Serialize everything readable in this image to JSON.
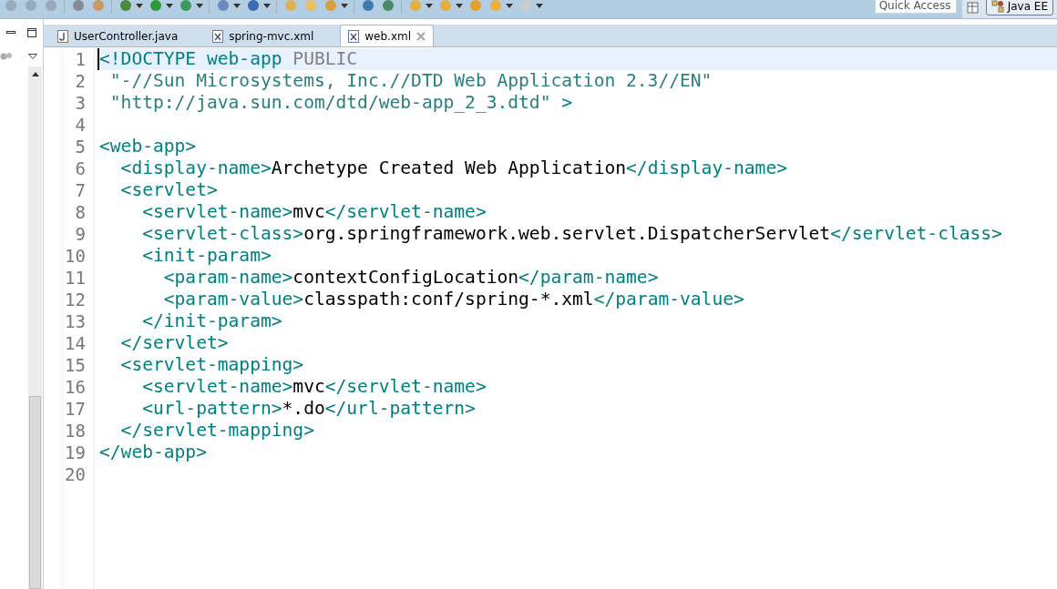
{
  "toolbar": {
    "quick_access": {
      "placeholder": "Quick Access"
    },
    "perspective": {
      "label": "Java EE",
      "selected": true
    }
  },
  "tabs": [
    {
      "label": "UserController.java",
      "kind": "java",
      "selected": false
    },
    {
      "label": "spring-mvc.xml",
      "kind": "xml",
      "selected": false
    },
    {
      "label": "web.xml",
      "kind": "xml",
      "selected": true
    }
  ],
  "editor": {
    "lines": [
      {
        "number": "1",
        "current": true,
        "tokens": [
          {
            "kind": "tag",
            "text": "<!DOCTYPE web-app "
          },
          {
            "kind": "keyword",
            "text": "PUBLIC"
          }
        ]
      },
      {
        "number": "2",
        "current": false,
        "tokens": [
          {
            "kind": "string",
            "text": " \"-//Sun Microsystems, Inc.//DTD Web Application 2.3//EN\""
          }
        ]
      },
      {
        "number": "3",
        "current": false,
        "tokens": [
          {
            "kind": "string",
            "text": " \"http://java.sun.com/dtd/web-app_2_3.dtd\""
          },
          {
            "kind": "tag",
            "text": " >"
          }
        ]
      },
      {
        "number": "4",
        "current": false
      },
      {
        "number": "5",
        "current": false,
        "tokens": [
          {
            "kind": "tag",
            "text": "<web-app>"
          }
        ]
      },
      {
        "number": "6",
        "current": false,
        "tokens": [
          {
            "kind": "tag",
            "text": "  <display-name>"
          },
          {
            "kind": "text",
            "text": "Archetype Created Web Application"
          },
          {
            "kind": "tag",
            "text": "</display-name>"
          }
        ]
      },
      {
        "number": "7",
        "current": false,
        "tokens": [
          {
            "kind": "tag",
            "text": "  <servlet>"
          }
        ]
      },
      {
        "number": "8",
        "current": false,
        "tokens": [
          {
            "kind": "tag",
            "text": "    <servlet-name>"
          },
          {
            "kind": "text",
            "text": "mvc"
          },
          {
            "kind": "tag",
            "text": "</servlet-name>"
          }
        ]
      },
      {
        "number": "9",
        "current": false,
        "tokens": [
          {
            "kind": "tag",
            "text": "    <servlet-class>"
          },
          {
            "kind": "text",
            "text": "org.springframework.web.servlet.DispatcherServlet"
          },
          {
            "kind": "tag",
            "text": "</servlet-class>"
          }
        ]
      },
      {
        "number": "10",
        "current": false,
        "tokens": [
          {
            "kind": "tag",
            "text": "    <init-param>"
          }
        ]
      },
      {
        "number": "11",
        "current": false,
        "tokens": [
          {
            "kind": "tag",
            "text": "      <param-name>"
          },
          {
            "kind": "text",
            "text": "contextConfigLocation"
          },
          {
            "kind": "tag",
            "text": "</param-name>"
          }
        ]
      },
      {
        "number": "12",
        "current": false,
        "tokens": [
          {
            "kind": "tag",
            "text": "      <param-value>"
          },
          {
            "kind": "text",
            "text": "classpath:conf/spring-*.xml"
          },
          {
            "kind": "tag",
            "text": "</param-value>"
          }
        ]
      },
      {
        "number": "13",
        "current": false,
        "tokens": [
          {
            "kind": "tag",
            "text": "    </init-param>"
          }
        ]
      },
      {
        "number": "14",
        "current": false,
        "tokens": [
          {
            "kind": "tag",
            "text": "  </servlet>"
          }
        ]
      },
      {
        "number": "15",
        "current": false,
        "tokens": [
          {
            "kind": "tag",
            "text": "  <servlet-mapping>"
          }
        ]
      },
      {
        "number": "16",
        "current": false,
        "tokens": [
          {
            "kind": "tag",
            "text": "    <servlet-name>"
          },
          {
            "kind": "text",
            "text": "mvc"
          },
          {
            "kind": "tag",
            "text": "</servlet-name>"
          }
        ]
      },
      {
        "number": "17",
        "current": false,
        "tokens": [
          {
            "kind": "tag",
            "text": "    <url-pattern>"
          },
          {
            "kind": "text",
            "text": "*.do"
          },
          {
            "kind": "tag",
            "text": "</url-pattern>"
          }
        ]
      },
      {
        "number": "18",
        "current": false,
        "tokens": [
          {
            "kind": "tag",
            "text": "  </servlet-mapping>"
          }
        ]
      },
      {
        "number": "19",
        "current": false,
        "tokens": [
          {
            "kind": "tag",
            "text": "</web-app>"
          }
        ]
      },
      {
        "number": "20",
        "current": false
      }
    ]
  }
}
